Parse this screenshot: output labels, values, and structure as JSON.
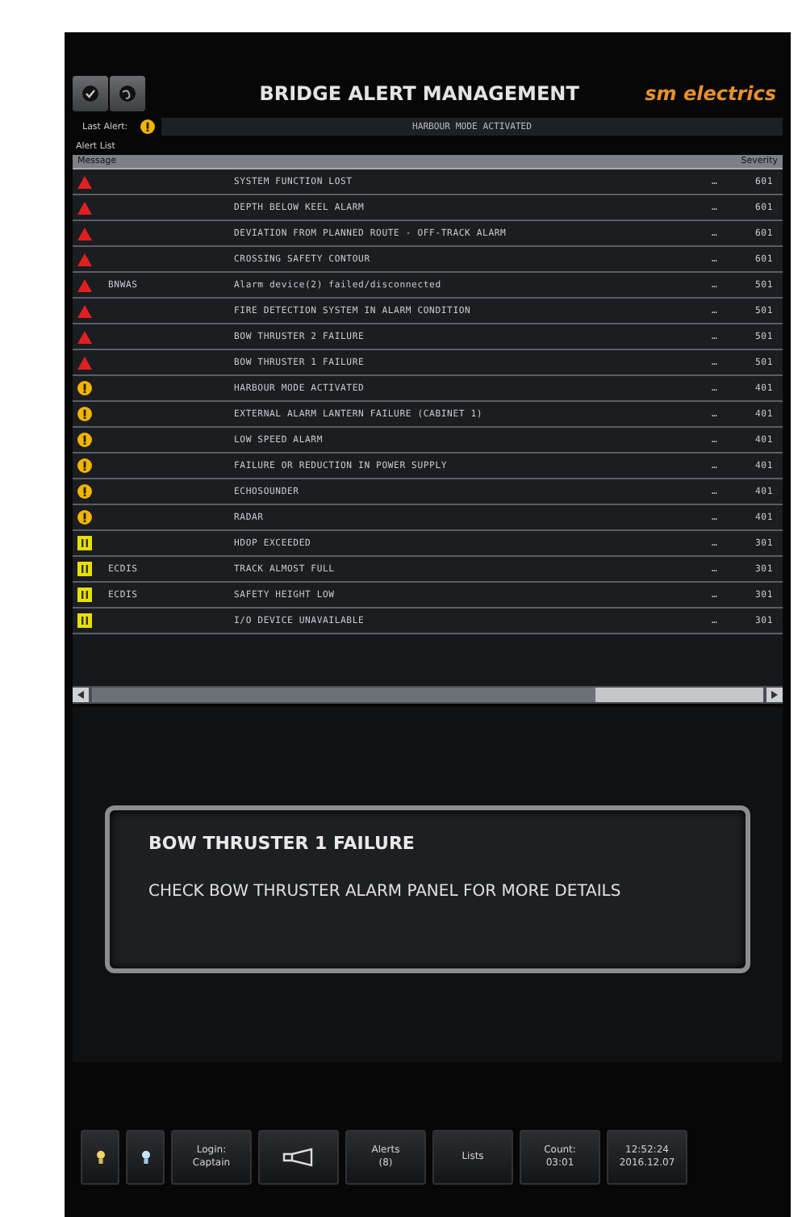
{
  "header": {
    "title": "BRIDGE ALERT MANAGEMENT",
    "brand": "sm electrics"
  },
  "last_alert": {
    "label": "Last Alert:",
    "kind": "warning",
    "message": "HARBOUR MODE ACTIVATED"
  },
  "alert_list": {
    "label": "Alert List",
    "columns": [
      "Message",
      "Severity"
    ],
    "rows": [
      {
        "kind": "alarm",
        "source": "",
        "message": "SYSTEM FUNCTION LOST",
        "column_4": "…",
        "severity": "601"
      },
      {
        "kind": "alarm",
        "source": "",
        "message": "DEPTH BELOW KEEL ALARM",
        "column_4": "…",
        "severity": "601"
      },
      {
        "kind": "alarm",
        "source": "",
        "message": "DEVIATION FROM PLANNED ROUTE - OFF-TRACK ALARM",
        "column_4": "…",
        "severity": "601"
      },
      {
        "kind": "alarm",
        "source": "",
        "message": "CROSSING SAFETY CONTOUR",
        "column_4": "…",
        "severity": "601"
      },
      {
        "kind": "alarm",
        "source": "BNWAS",
        "message": "Alarm device(2) failed/disconnected",
        "column_4": "…",
        "severity": "501"
      },
      {
        "kind": "alarm",
        "source": "",
        "message": "FIRE DETECTION SYSTEM IN ALARM CONDITION",
        "column_4": "…",
        "severity": "501"
      },
      {
        "kind": "alarm",
        "source": "",
        "message": "BOW THRUSTER 2 FAILURE",
        "column_4": "…",
        "severity": "501"
      },
      {
        "kind": "alarm",
        "source": "",
        "message": "BOW THRUSTER 1 FAILURE",
        "column_4": "…",
        "severity": "501"
      },
      {
        "kind": "warning",
        "source": "",
        "message": "HARBOUR MODE ACTIVATED",
        "column_4": "…",
        "severity": "401"
      },
      {
        "kind": "warning",
        "source": "",
        "message": "EXTERNAL ALARM LANTERN FAILURE (CABINET 1)",
        "column_4": "…",
        "severity": "401"
      },
      {
        "kind": "warning",
        "source": "",
        "message": "LOW SPEED ALARM",
        "column_4": "…",
        "severity": "401"
      },
      {
        "kind": "warning",
        "source": "",
        "message": "FAILURE OR REDUCTION IN POWER SUPPLY",
        "column_4": "…",
        "severity": "401"
      },
      {
        "kind": "warning",
        "source": "",
        "message": "ECHOSOUNDER",
        "column_4": "…",
        "severity": "401"
      },
      {
        "kind": "warning",
        "source": "",
        "message": "RADAR",
        "column_4": "…",
        "severity": "401"
      },
      {
        "kind": "caution",
        "source": "",
        "message": "HDOP EXCEEDED",
        "column_4": "…",
        "severity": "301"
      },
      {
        "kind": "caution",
        "source": "ECDIS",
        "message": "TRACK ALMOST FULL",
        "column_4": "…",
        "severity": "301"
      },
      {
        "kind": "caution",
        "source": "ECDIS",
        "message": "SAFETY HEIGHT LOW",
        "column_4": "…",
        "severity": "301"
      },
      {
        "kind": "caution",
        "source": "",
        "message": "I/O DEVICE UNAVAILABLE",
        "column_4": "…",
        "severity": "301"
      }
    ]
  },
  "detail": {
    "title": "BOW THRUSTER 1 FAILURE",
    "text": "CHECK BOW THRUSTER ALARM PANEL FOR MORE DETAILS"
  },
  "bottom_bar": [
    {
      "kind": "day-lamp"
    },
    {
      "kind": "night-lamp"
    },
    {
      "kind": "text",
      "lines": [
        "Login:",
        "Captain"
      ]
    },
    {
      "kind": "horn"
    },
    {
      "kind": "text",
      "lines": [
        "Alerts",
        "(8)"
      ]
    },
    {
      "kind": "text",
      "lines": [
        "Lists"
      ]
    },
    {
      "kind": "text",
      "lines": [
        "Count:",
        "03:01"
      ]
    },
    {
      "kind": "text",
      "lines": [
        "12:52:24",
        "2016.12.07"
      ]
    }
  ]
}
